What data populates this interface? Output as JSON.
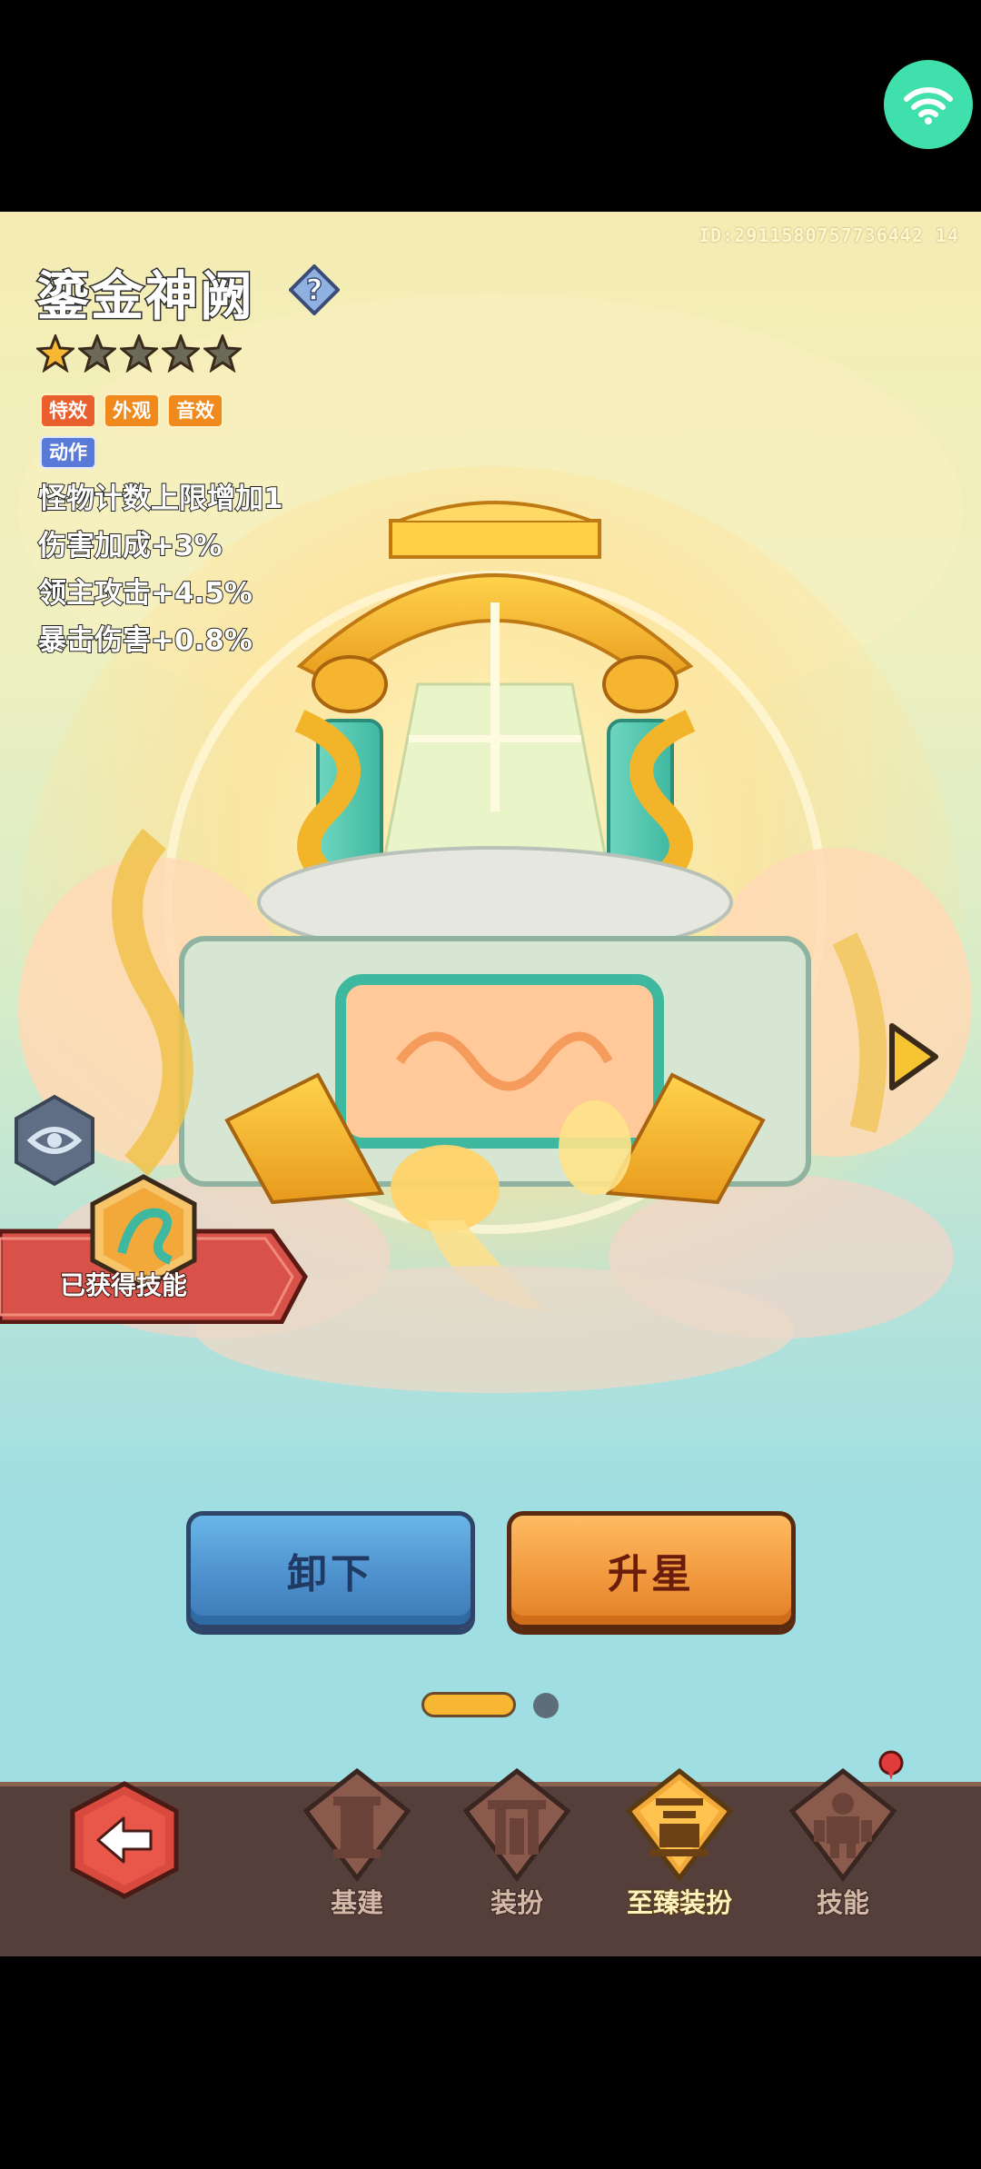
{
  "status_bar": {
    "wifi_icon": "wifi-icon"
  },
  "header": {
    "id_text": "ID:2911580757736442 14",
    "title": "鎏金神阙",
    "help_icon": "question-icon"
  },
  "rating": {
    "filled": 1,
    "total": 5
  },
  "tags": [
    "特效",
    "外观",
    "音效"
  ],
  "action_tag": "动作",
  "stats": [
    {
      "label": "怪物计数上限增加",
      "value": "1"
    },
    {
      "label": "伤害加成",
      "value": "+3%"
    },
    {
      "label": "领主攻击",
      "value": "+4.5%"
    },
    {
      "label": "暴击伤害",
      "value": "+0.8%"
    }
  ],
  "skill_banner": {
    "label": "已获得技能",
    "icon": "dragon-skill-icon"
  },
  "buttons": {
    "unequip": "卸下",
    "upstar": "升星"
  },
  "pager": {
    "current": 1,
    "total": 2
  },
  "nav": {
    "back_icon": "back-arrow-icon",
    "items": [
      {
        "label": "基建",
        "icon": "pillar-icon",
        "active": false
      },
      {
        "label": "装扮",
        "icon": "gate-icon",
        "active": false
      },
      {
        "label": "至臻装扮",
        "icon": "palace-icon",
        "active": true
      },
      {
        "label": "技能",
        "icon": "robot-icon",
        "active": false
      }
    ]
  },
  "colors": {
    "accent_orange": "#f0973c",
    "accent_blue": "#4b8ecb",
    "nav_bg": "#543f3a"
  }
}
